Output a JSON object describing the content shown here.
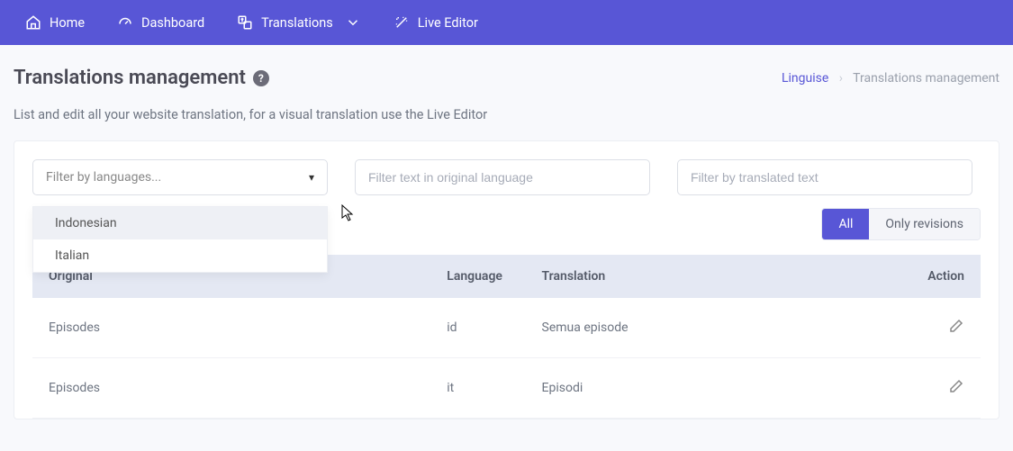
{
  "nav": {
    "home": "Home",
    "dashboard": "Dashboard",
    "translations": "Translations",
    "live_editor": "Live Editor"
  },
  "page": {
    "title": "Translations management",
    "subtitle": "List and edit all your website translation, for a visual translation use the Live Editor"
  },
  "breadcrumb": {
    "root": "Linguise",
    "sep": "›",
    "current": "Translations management"
  },
  "filters": {
    "language_placeholder": "Filter by languages...",
    "original_placeholder": "Filter text in original language",
    "translated_placeholder": "Filter by translated text",
    "dropdown": [
      "Indonesian",
      "Italian"
    ]
  },
  "toggle": {
    "all": "All",
    "only_revisions": "Only revisions"
  },
  "table": {
    "headers": {
      "original": "Original",
      "language": "Language",
      "translation": "Translation",
      "action": "Action"
    },
    "rows": [
      {
        "original": "Episodes",
        "language": "id",
        "translation": "Semua episode"
      },
      {
        "original": "Episodes",
        "language": "it",
        "translation": "Episodi"
      }
    ]
  }
}
